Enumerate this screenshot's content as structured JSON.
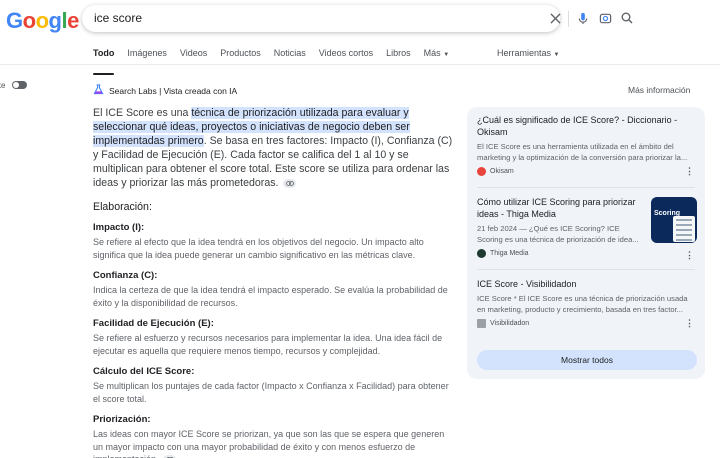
{
  "logo": {
    "letters": [
      "G",
      "o",
      "o",
      "g",
      "l",
      "e"
    ],
    "colors": [
      "#4285f4",
      "#ea4335",
      "#fbbc05",
      "#4285f4",
      "#34a853",
      "#ea4335"
    ]
  },
  "search": {
    "query": "ice score"
  },
  "tabs": [
    "Todo",
    "Imágenes",
    "Videos",
    "Productos",
    "Noticias",
    "Videos cortos",
    "Libros",
    "Más"
  ],
  "tools_label": "Herramientas",
  "toggle_label": "ke",
  "ai": {
    "labs_label": "Search Labs | Vista creada con IA",
    "more_info": "Más información",
    "summary_pre": "El ICE Score es una ",
    "summary_hl": "técnica de priorización utilizada para evaluar y seleccionar qué ideas, proyectos o iniciativas de negocio deben ser implementadas primero",
    "summary_post": ". Se basa en tres factores: Impacto (I), Confianza (C) y Facilidad de Ejecución (E). Cada factor se califica del 1 al 10 y se multiplican para obtener el score total. Este score se utiliza para ordenar las ideas y priorizar las más prometedoras.",
    "elab_title": "Elaboración:",
    "items": [
      {
        "h": "Impacto (I):",
        "t": "Se refiere al efecto que la idea tendrá en los objetivos del negocio. Un impacto alto significa que la idea puede generar un cambio significativo en las métricas clave."
      },
      {
        "h": "Confianza (C):",
        "t": "Indica la certeza de que la idea tendrá el impacto esperado. Se evalúa la probabilidad de éxito y la disponibilidad de recursos."
      },
      {
        "h": "Facilidad de Ejecución (E):",
        "t": "Se refiere al esfuerzo y recursos necesarios para implementar la idea. Una idea fácil de ejecutar es aquella que requiere menos tiempo, recursos y complejidad."
      },
      {
        "h": "Cálculo del ICE Score:",
        "t": "Se multiplican los puntajes de cada factor (Impacto x Confianza x Facilidad) para obtener el score total."
      },
      {
        "h": "Priorización:",
        "t": "Las ideas con mayor ICE Score se priorizan, ya que son las que se espera que generen un mayor impacto con una mayor probabilidad de éxito y con menos esfuerzo de implementación."
      }
    ]
  },
  "sources": [
    {
      "title": "¿Cuál es significado de ICE Score? - Diccionario - Okisam",
      "desc": "El ICE Score es una herramienta utilizada en el ámbito del marketing y la optimización de la conversión para priorizar la...",
      "site": "Okisam",
      "fav_color": "#e8453c"
    },
    {
      "title": "Cómo utilizar ICE Scoring para priorizar ideas - Thiga Media",
      "desc": "21 feb 2024 — ¿Qué es ICE Scoring? ICE Scoring es una técnica de priorización de idea...",
      "site": "Thiga Media",
      "fav_color": "#1e3a2f",
      "thumb_word": "Scoring"
    },
    {
      "title": "ICE Score - Visibilidadon",
      "desc": "ICE Score * El ICE Score es una técnica de priorización usada en marketing, producto y crecimiento, basada en tres factor...",
      "site": "Visibilidadon",
      "fav_color": "#9aa0a6"
    }
  ],
  "show_all": "Mostrar todos"
}
